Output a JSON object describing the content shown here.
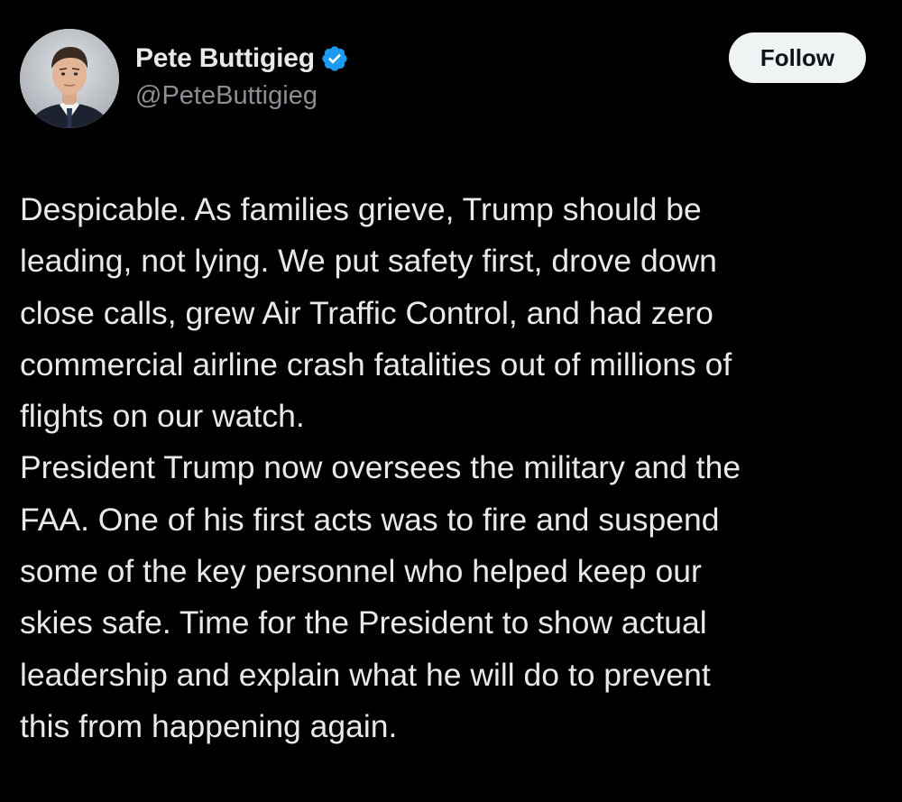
{
  "author": {
    "display_name": "Pete Buttigieg",
    "handle": "@PeteButtigieg",
    "verified": true,
    "avatar_icon": "profile-photo",
    "verified_icon": "verified-badge-icon",
    "verified_color": "#1d9bf0"
  },
  "actions": {
    "follow_label": "Follow"
  },
  "tweet": {
    "lines": [
      "Despicable. As families grieve, Trump should be",
      "leading, not lying. We put safety first, drove down",
      "close calls, grew Air Traffic Control, and had zero",
      "commercial airline crash fatalities out of millions of",
      "flights on our watch.",
      "President Trump now oversees the military and the",
      "FAA. One of his first acts was to fire and suspend",
      "some of the key personnel who helped keep our",
      "skies safe. Time for the President to show actual",
      "leadership and explain what he will do to prevent",
      "this from happening again."
    ]
  },
  "colors": {
    "background": "#000000",
    "text": "#e7e9ea",
    "secondary_text": "#8b8f94",
    "button_bg": "#eff3f4",
    "button_text": "#0f1419"
  }
}
